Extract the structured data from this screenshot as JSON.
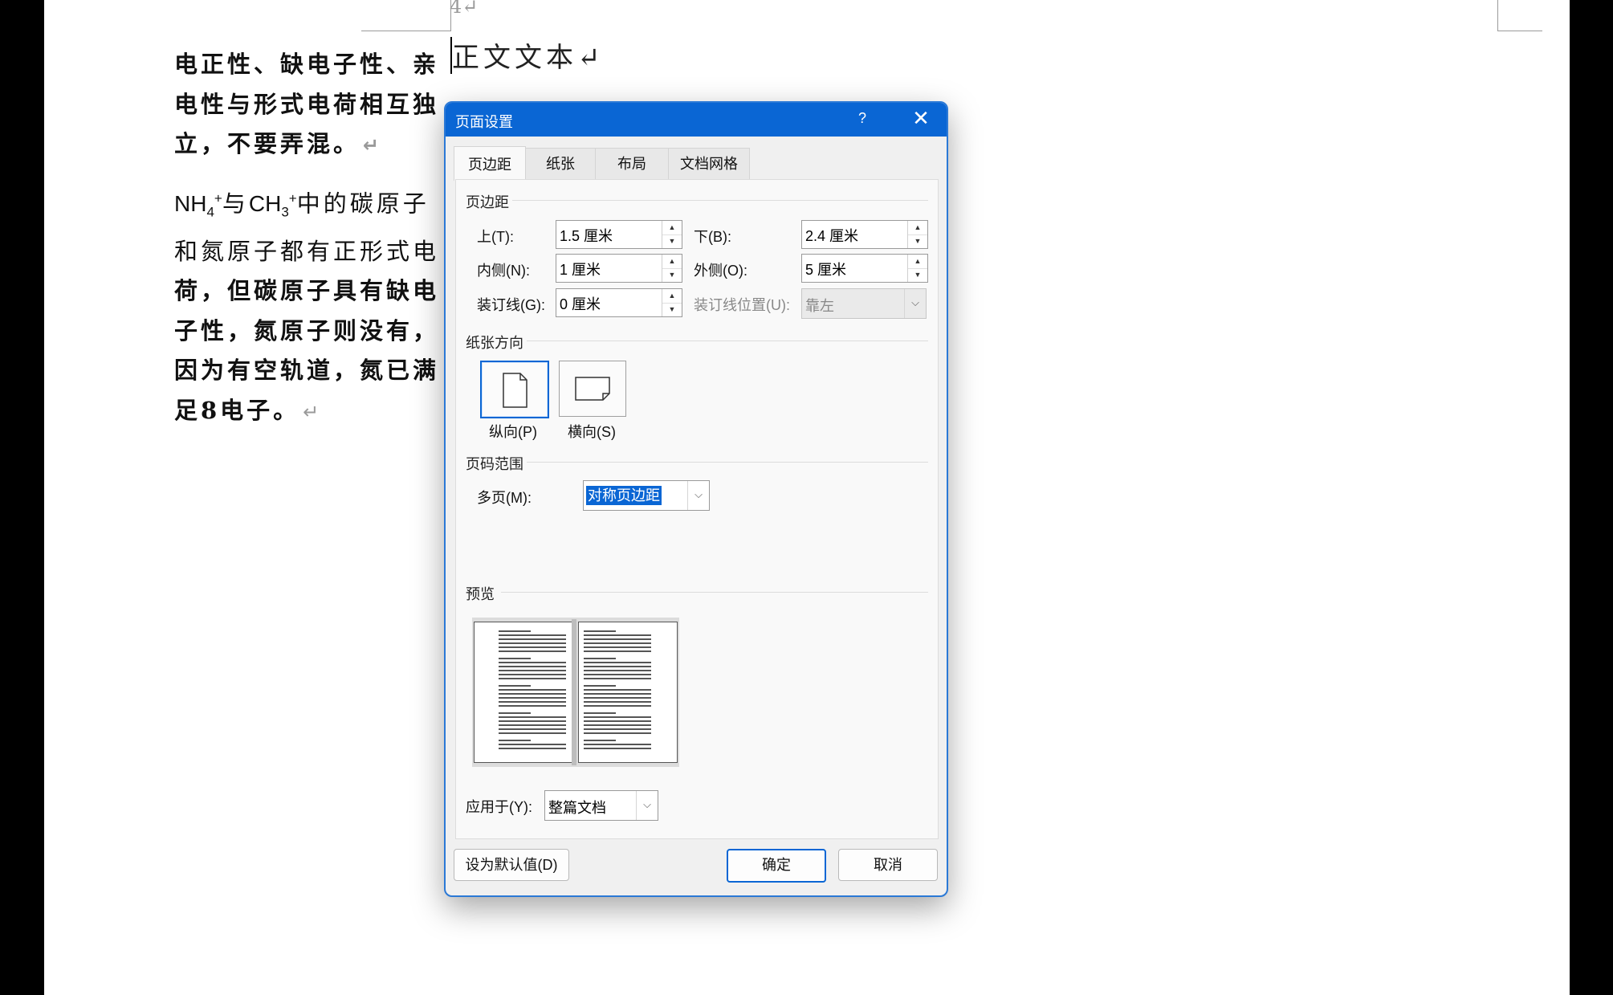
{
  "document": {
    "page_marker": "4↵",
    "heading": "正文文本↵",
    "para1": "电正性、缺电子性、亲电性与形式电荷相互独立，不要弄混。",
    "para2": {
      "formula_a_base": "NH",
      "formula_a_sub": "4",
      "formula_a_sup": "+",
      "connector": "与",
      "formula_b_base": "CH",
      "formula_b_sub": "3",
      "formula_b_sup": "+",
      "text_regular": "中的碳原子和氮原子都有正形式电",
      "text_bold": "荷，但碳原子具有缺电子性，氮原子则没有，因为有空轨道，氮已满足8电子。"
    },
    "paragraph_mark": "↵"
  },
  "dialog": {
    "title": "页面设置",
    "help": "?",
    "close": "✕",
    "tabs": [
      "页边距",
      "纸张",
      "布局",
      "文档网格"
    ],
    "margins": {
      "section": "页边距",
      "top_label": "上(T):",
      "top_value": "1.5 厘米",
      "bottom_label": "下(B):",
      "bottom_value": "2.4 厘米",
      "inside_label": "内侧(N):",
      "inside_value": "1 厘米",
      "outside_label": "外侧(O):",
      "outside_value": "5 厘米",
      "gutter_label": "装订线(G):",
      "gutter_value": "0 厘米",
      "gutter_pos_label": "装订线位置(U):",
      "gutter_pos_value": "靠左"
    },
    "orientation": {
      "section": "纸张方向",
      "portrait": "纵向(P)",
      "landscape": "横向(S)",
      "selected": "portrait"
    },
    "pages": {
      "section": "页码范围",
      "multiple_label": "多页(M):",
      "multiple_value": "对称页边距"
    },
    "preview": {
      "section": "预览"
    },
    "apply": {
      "label": "应用于(Y):",
      "value": "整篇文档"
    },
    "buttons": {
      "default": "设为默认值(D)",
      "ok": "确定",
      "cancel": "取消"
    }
  },
  "colors": {
    "accent": "#0a66d4",
    "dialog_bg": "#f0f0f0",
    "panel_bg": "#f9f9f9",
    "backdrop": "#000000"
  },
  "icons": [
    "help-icon",
    "close-icon",
    "spin-up-icon",
    "spin-down-icon",
    "chevron-down-icon",
    "portrait-page-icon",
    "landscape-page-icon"
  ]
}
